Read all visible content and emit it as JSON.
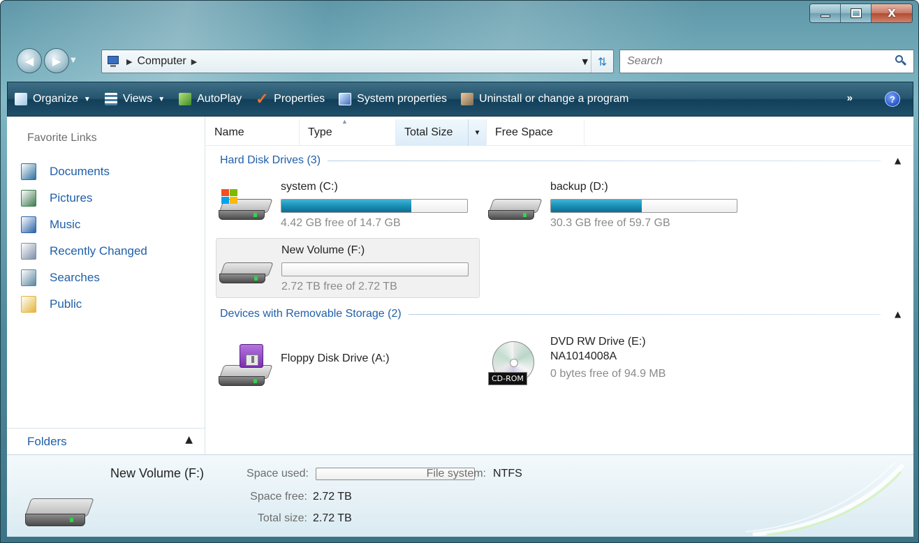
{
  "window": {
    "caption": {
      "minimize": "",
      "maximize": "",
      "close": "X"
    }
  },
  "address": {
    "location": "Computer",
    "search_placeholder": "Search"
  },
  "toolbar": {
    "organize": "Organize",
    "views": "Views",
    "autoplay": "AutoPlay",
    "properties": "Properties",
    "system_properties": "System properties",
    "uninstall": "Uninstall or change a program",
    "more": "»",
    "help": "?"
  },
  "nav_pane": {
    "favorites_title": "Favorite Links",
    "items": [
      {
        "label": "Documents",
        "icon": "documents-icon",
        "color": "#2d6f9f"
      },
      {
        "label": "Pictures",
        "icon": "pictures-icon",
        "color": "#3e7a4f"
      },
      {
        "label": "Music",
        "icon": "music-icon",
        "color": "#2a62a8"
      },
      {
        "label": "Recently Changed",
        "icon": "recently-changed-icon",
        "color": "#7d8fa6"
      },
      {
        "label": "Searches",
        "icon": "searches-icon",
        "color": "#5b86a0"
      },
      {
        "label": "Public",
        "icon": "public-folder-icon",
        "color": "#e4b43a"
      }
    ],
    "folders_label": "Folders"
  },
  "columns": {
    "name": "Name",
    "type": "Type",
    "total_size": "Total Size",
    "free_space": "Free Space"
  },
  "groups": {
    "hard_disks": {
      "title": "Hard Disk Drives (3)",
      "drives": [
        {
          "name": "system (C:)",
          "free_text": "4.42 GB free of 14.7 GB",
          "used_fraction": 0.7,
          "icon": "system-drive-icon"
        },
        {
          "name": "backup (D:)",
          "free_text": "30.3 GB free of 59.7 GB",
          "used_fraction": 0.49,
          "icon": "hard-drive-icon"
        },
        {
          "name": "New Volume (F:)",
          "free_text": "2.72 TB free of 2.72 TB",
          "used_fraction": 0.0,
          "icon": "hard-drive-icon",
          "selected": true
        }
      ]
    },
    "removable": {
      "title": "Devices with Removable Storage (2)",
      "devices": [
        {
          "name": "Floppy Disk Drive (A:)",
          "icon": "floppy-drive-icon"
        },
        {
          "name": "DVD RW Drive (E:)",
          "line2": "NA1014008A",
          "free_text": "0 bytes free of 94.9 MB",
          "icon": "dvd-drive-icon",
          "badge": "CD-ROM"
        }
      ]
    }
  },
  "details": {
    "name": "New Volume (F:)",
    "space_used_label": "Space used:",
    "used_fraction": 0.0,
    "file_system_label": "File system:",
    "file_system_value": "NTFS",
    "space_free_label": "Space free:",
    "space_free_value": "2.72 TB",
    "total_size_label": "Total size:",
    "total_size_value": "2.72 TB"
  },
  "colors": {
    "link_blue": "#1f5fa8",
    "toolbar_dark": "#123f59",
    "bar_fill": "#1b8fb6"
  }
}
